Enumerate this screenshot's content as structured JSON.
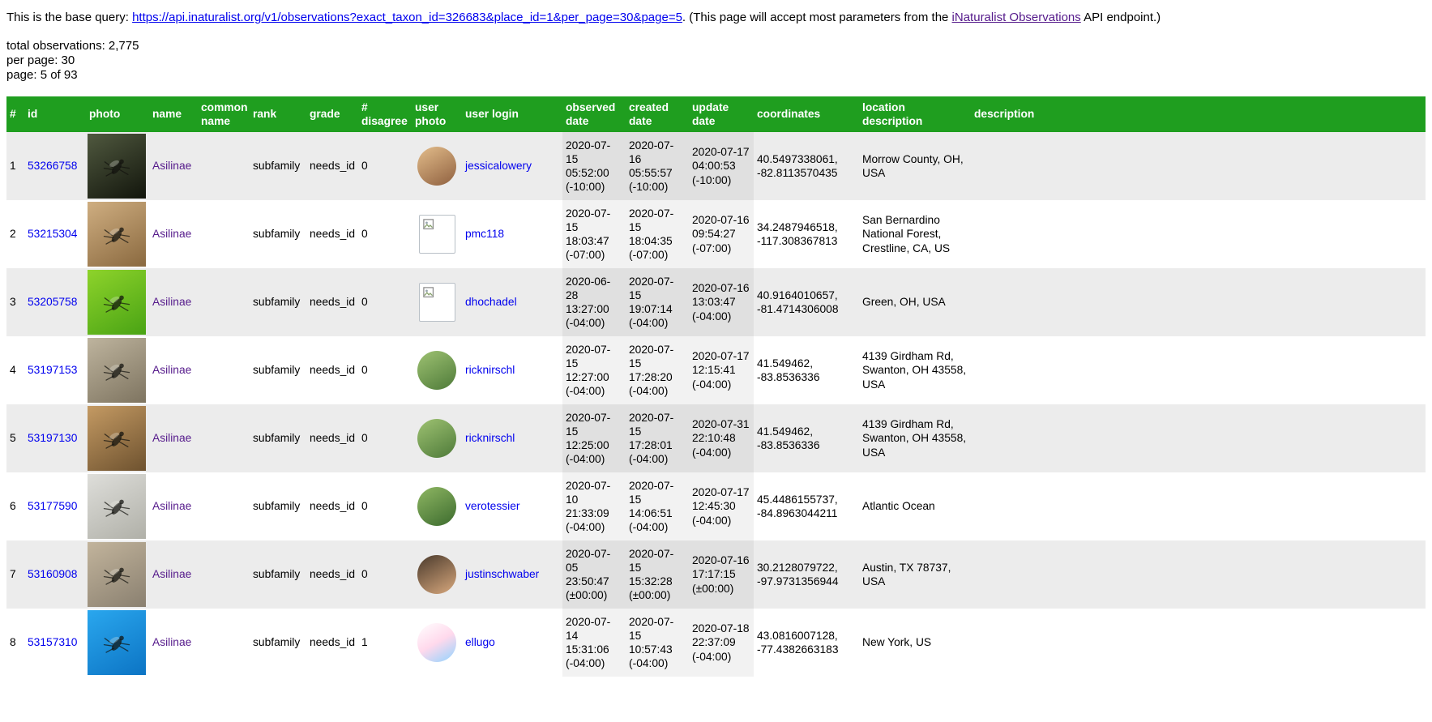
{
  "intro": {
    "prefix": "This is the base query: ",
    "url": "https://api.inaturalist.org/v1/observations?exact_taxon_id=326683&place_id=1&per_page=30&page=5",
    "middle": ". (This page will accept most parameters from the ",
    "endpoint_link": "iNaturalist Observations",
    "suffix": " API endpoint.)"
  },
  "stats": {
    "total": "total observations: 2,775",
    "per_page": "per page: 30",
    "page": "page: 5 of 93"
  },
  "table": {
    "headers": [
      "#",
      "id",
      "photo",
      "name",
      "common name",
      "rank",
      "grade",
      "# disagree",
      "user photo",
      "user login",
      "observed date",
      "created date",
      "update date",
      "coordinates",
      "location description",
      "description"
    ],
    "rows": [
      {
        "num": "1",
        "id": "53266758",
        "name": "Asilinae",
        "common_name": "",
        "rank": "subfamily",
        "grade": "needs_id",
        "disagree": "0",
        "user_login": "jessicalowery",
        "observed": "2020-07-15 05:52:00 (-10:00)",
        "created": "2020-07-16 05:55:57 (-10:00)",
        "updated": "2020-07-17 04:00:53 (-10:00)",
        "coordinates": "40.5497338061, -82.8113570435",
        "location": "Morrow County, OH, USA",
        "description": "",
        "photo_colors": [
          "#50593f",
          "#12150c"
        ],
        "avatar": "photo",
        "avatar_colors": [
          "#e3bd8b",
          "#8f603f"
        ]
      },
      {
        "num": "2",
        "id": "53215304",
        "name": "Asilinae",
        "common_name": "",
        "rank": "subfamily",
        "grade": "needs_id",
        "disagree": "0",
        "user_login": "pmc118",
        "observed": "2020-07-15 18:03:47 (-07:00)",
        "created": "2020-07-15 18:04:35 (-07:00)",
        "updated": "2020-07-16 09:54:27 (-07:00)",
        "coordinates": "34.2487946518, -117.308367813",
        "location": "San Bernardino National Forest, Crestline, CA, US",
        "description": "",
        "photo_colors": [
          "#cfae81",
          "#8a693f"
        ],
        "avatar": "broken",
        "avatar_colors": []
      },
      {
        "num": "3",
        "id": "53205758",
        "name": "Asilinae",
        "common_name": "",
        "rank": "subfamily",
        "grade": "needs_id",
        "disagree": "0",
        "user_login": "dhochadel",
        "observed": "2020-06-28 13:27:00 (-04:00)",
        "created": "2020-07-15 19:07:14 (-04:00)",
        "updated": "2020-07-16 13:03:47 (-04:00)",
        "coordinates": "40.9164010657, -81.4714306008",
        "location": "Green, OH, USA",
        "description": "",
        "photo_colors": [
          "#8ed32b",
          "#49a314"
        ],
        "avatar": "broken",
        "avatar_colors": []
      },
      {
        "num": "4",
        "id": "53197153",
        "name": "Asilinae",
        "common_name": "",
        "rank": "subfamily",
        "grade": "needs_id",
        "disagree": "0",
        "user_login": "ricknirschl",
        "observed": "2020-07-15 12:27:00 (-04:00)",
        "created": "2020-07-15 17:28:20 (-04:00)",
        "updated": "2020-07-17 12:15:41 (-04:00)",
        "coordinates": "41.549462, -83.8536336",
        "location": "4139 Girdham Rd, Swanton, OH 43558, USA",
        "description": "",
        "photo_colors": [
          "#beb49e",
          "#7e7460"
        ],
        "avatar": "photo",
        "avatar_colors": [
          "#9ec272",
          "#4e7a39"
        ]
      },
      {
        "num": "5",
        "id": "53197130",
        "name": "Asilinae",
        "common_name": "",
        "rank": "subfamily",
        "grade": "needs_id",
        "disagree": "0",
        "user_login": "ricknirschl",
        "observed": "2020-07-15 12:25:00 (-04:00)",
        "created": "2020-07-15 17:28:01 (-04:00)",
        "updated": "2020-07-31 22:10:48 (-04:00)",
        "coordinates": "41.549462, -83.8536336",
        "location": "4139 Girdham Rd, Swanton, OH 43558, USA",
        "description": "",
        "photo_colors": [
          "#c49a63",
          "#6e522f"
        ],
        "avatar": "photo",
        "avatar_colors": [
          "#9ec272",
          "#4e7a39"
        ]
      },
      {
        "num": "6",
        "id": "53177590",
        "name": "Asilinae",
        "common_name": "",
        "rank": "subfamily",
        "grade": "needs_id",
        "disagree": "0",
        "user_login": "verotessier",
        "observed": "2020-07-10 21:33:09 (-04:00)",
        "created": "2020-07-15 14:06:51 (-04:00)",
        "updated": "2020-07-17 12:45:30 (-04:00)",
        "coordinates": "45.4486155737, -84.8963044211",
        "location": "Atlantic Ocean",
        "description": "",
        "photo_colors": [
          "#dededa",
          "#b0b0a8"
        ],
        "avatar": "photo",
        "avatar_colors": [
          "#8fb763",
          "#3c6b2e"
        ]
      },
      {
        "num": "7",
        "id": "53160908",
        "name": "Asilinae",
        "common_name": "",
        "rank": "subfamily",
        "grade": "needs_id",
        "disagree": "0",
        "user_login": "justinschwaber",
        "observed": "2020-07-05 23:50:47 (±00:00)",
        "created": "2020-07-15 15:32:28 (±00:00)",
        "updated": "2020-07-16 17:17:15 (±00:00)",
        "coordinates": "30.2128079722, -97.9731356944",
        "location": "Austin, TX 78737, USA",
        "description": "",
        "photo_colors": [
          "#c2b49c",
          "#8a8070"
        ],
        "avatar": "photo",
        "avatar_colors": [
          "#4a3a2c",
          "#d8a87d"
        ]
      },
      {
        "num": "8",
        "id": "53157310",
        "name": "Asilinae",
        "common_name": "",
        "rank": "subfamily",
        "grade": "needs_id",
        "disagree": "1",
        "user_login": "ellugo",
        "observed": "2020-07-14 15:31:06 (-04:00)",
        "created": "2020-07-15 10:57:43 (-04:00)",
        "updated": "2020-07-18 22:37:09 (-04:00)",
        "coordinates": "43.0816007128, -77.4382663183",
        "location": "New York, US",
        "description": "",
        "photo_colors": [
          "#2aa7ee",
          "#0c74c4"
        ],
        "avatar": "photo",
        "avatar_colors": [
          "#ffffff",
          "#ffd9ec",
          "#8fd3ff"
        ]
      }
    ]
  },
  "colors": {
    "header_bg": "#1f9e1f",
    "link_blue": "#0000ee",
    "link_visited": "#551a8b",
    "row_alt": "#ececec"
  }
}
